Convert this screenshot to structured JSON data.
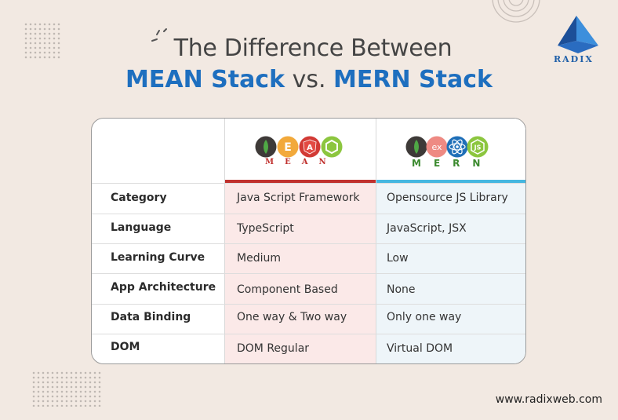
{
  "title": {
    "line1": "The Difference Between",
    "line2_a": "MEAN Stack",
    "line2_vs": " vs. ",
    "line2_b": "MERN Stack"
  },
  "brand": {
    "name": "RADIX",
    "website": "www.radixweb.com"
  },
  "table": {
    "columns": [
      {
        "key": "mean",
        "letters": "MEAN",
        "icons": [
          "mongodb-leaf-icon",
          "express-e-icon",
          "angular-a-icon",
          "nodejs-hex-icon"
        ]
      },
      {
        "key": "mern",
        "letters": "MERN",
        "icons": [
          "mongodb-leaf-icon",
          "express-ex-icon",
          "react-atom-icon",
          "nodejs-js-icon"
        ]
      }
    ],
    "rows": [
      {
        "category": "Category",
        "mean": "Java Script Framework",
        "mern": "Opensource JS Library"
      },
      {
        "category": "Language",
        "mean": "TypeScript",
        "mern": "JavaScript, JSX"
      },
      {
        "category": "Learning Curve",
        "mean": "Medium",
        "mern": "Low"
      },
      {
        "category": "App Architecture",
        "mean": "Component Based",
        "mern": "None"
      },
      {
        "category": "Data Binding",
        "mean": "One way & Two way",
        "mern": "Only one way"
      },
      {
        "category": "DOM",
        "mean": "DOM Regular",
        "mern": "Virtual DOM"
      }
    ]
  },
  "colors": {
    "accent_blue": "#1e6fbf",
    "mean_bar": "#c0312e",
    "mern_bar": "#45b7e0"
  }
}
